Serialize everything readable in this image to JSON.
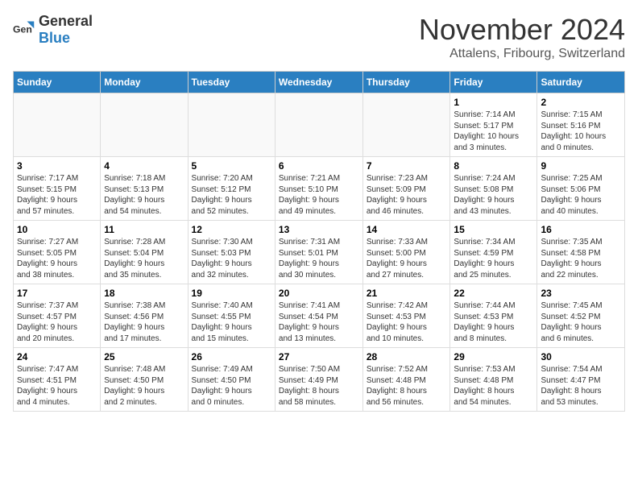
{
  "header": {
    "logo_general": "General",
    "logo_blue": "Blue",
    "month_title": "November 2024",
    "subtitle": "Attalens, Fribourg, Switzerland"
  },
  "weekdays": [
    "Sunday",
    "Monday",
    "Tuesday",
    "Wednesday",
    "Thursday",
    "Friday",
    "Saturday"
  ],
  "weeks": [
    [
      {
        "day": "",
        "info": ""
      },
      {
        "day": "",
        "info": ""
      },
      {
        "day": "",
        "info": ""
      },
      {
        "day": "",
        "info": ""
      },
      {
        "day": "",
        "info": ""
      },
      {
        "day": "1",
        "info": "Sunrise: 7:14 AM\nSunset: 5:17 PM\nDaylight: 10 hours\nand 3 minutes."
      },
      {
        "day": "2",
        "info": "Sunrise: 7:15 AM\nSunset: 5:16 PM\nDaylight: 10 hours\nand 0 minutes."
      }
    ],
    [
      {
        "day": "3",
        "info": "Sunrise: 7:17 AM\nSunset: 5:15 PM\nDaylight: 9 hours\nand 57 minutes."
      },
      {
        "day": "4",
        "info": "Sunrise: 7:18 AM\nSunset: 5:13 PM\nDaylight: 9 hours\nand 54 minutes."
      },
      {
        "day": "5",
        "info": "Sunrise: 7:20 AM\nSunset: 5:12 PM\nDaylight: 9 hours\nand 52 minutes."
      },
      {
        "day": "6",
        "info": "Sunrise: 7:21 AM\nSunset: 5:10 PM\nDaylight: 9 hours\nand 49 minutes."
      },
      {
        "day": "7",
        "info": "Sunrise: 7:23 AM\nSunset: 5:09 PM\nDaylight: 9 hours\nand 46 minutes."
      },
      {
        "day": "8",
        "info": "Sunrise: 7:24 AM\nSunset: 5:08 PM\nDaylight: 9 hours\nand 43 minutes."
      },
      {
        "day": "9",
        "info": "Sunrise: 7:25 AM\nSunset: 5:06 PM\nDaylight: 9 hours\nand 40 minutes."
      }
    ],
    [
      {
        "day": "10",
        "info": "Sunrise: 7:27 AM\nSunset: 5:05 PM\nDaylight: 9 hours\nand 38 minutes."
      },
      {
        "day": "11",
        "info": "Sunrise: 7:28 AM\nSunset: 5:04 PM\nDaylight: 9 hours\nand 35 minutes."
      },
      {
        "day": "12",
        "info": "Sunrise: 7:30 AM\nSunset: 5:03 PM\nDaylight: 9 hours\nand 32 minutes."
      },
      {
        "day": "13",
        "info": "Sunrise: 7:31 AM\nSunset: 5:01 PM\nDaylight: 9 hours\nand 30 minutes."
      },
      {
        "day": "14",
        "info": "Sunrise: 7:33 AM\nSunset: 5:00 PM\nDaylight: 9 hours\nand 27 minutes."
      },
      {
        "day": "15",
        "info": "Sunrise: 7:34 AM\nSunset: 4:59 PM\nDaylight: 9 hours\nand 25 minutes."
      },
      {
        "day": "16",
        "info": "Sunrise: 7:35 AM\nSunset: 4:58 PM\nDaylight: 9 hours\nand 22 minutes."
      }
    ],
    [
      {
        "day": "17",
        "info": "Sunrise: 7:37 AM\nSunset: 4:57 PM\nDaylight: 9 hours\nand 20 minutes."
      },
      {
        "day": "18",
        "info": "Sunrise: 7:38 AM\nSunset: 4:56 PM\nDaylight: 9 hours\nand 17 minutes."
      },
      {
        "day": "19",
        "info": "Sunrise: 7:40 AM\nSunset: 4:55 PM\nDaylight: 9 hours\nand 15 minutes."
      },
      {
        "day": "20",
        "info": "Sunrise: 7:41 AM\nSunset: 4:54 PM\nDaylight: 9 hours\nand 13 minutes."
      },
      {
        "day": "21",
        "info": "Sunrise: 7:42 AM\nSunset: 4:53 PM\nDaylight: 9 hours\nand 10 minutes."
      },
      {
        "day": "22",
        "info": "Sunrise: 7:44 AM\nSunset: 4:53 PM\nDaylight: 9 hours\nand 8 minutes."
      },
      {
        "day": "23",
        "info": "Sunrise: 7:45 AM\nSunset: 4:52 PM\nDaylight: 9 hours\nand 6 minutes."
      }
    ],
    [
      {
        "day": "24",
        "info": "Sunrise: 7:47 AM\nSunset: 4:51 PM\nDaylight: 9 hours\nand 4 minutes."
      },
      {
        "day": "25",
        "info": "Sunrise: 7:48 AM\nSunset: 4:50 PM\nDaylight: 9 hours\nand 2 minutes."
      },
      {
        "day": "26",
        "info": "Sunrise: 7:49 AM\nSunset: 4:50 PM\nDaylight: 9 hours\nand 0 minutes."
      },
      {
        "day": "27",
        "info": "Sunrise: 7:50 AM\nSunset: 4:49 PM\nDaylight: 8 hours\nand 58 minutes."
      },
      {
        "day": "28",
        "info": "Sunrise: 7:52 AM\nSunset: 4:48 PM\nDaylight: 8 hours\nand 56 minutes."
      },
      {
        "day": "29",
        "info": "Sunrise: 7:53 AM\nSunset: 4:48 PM\nDaylight: 8 hours\nand 54 minutes."
      },
      {
        "day": "30",
        "info": "Sunrise: 7:54 AM\nSunset: 4:47 PM\nDaylight: 8 hours\nand 53 minutes."
      }
    ]
  ]
}
